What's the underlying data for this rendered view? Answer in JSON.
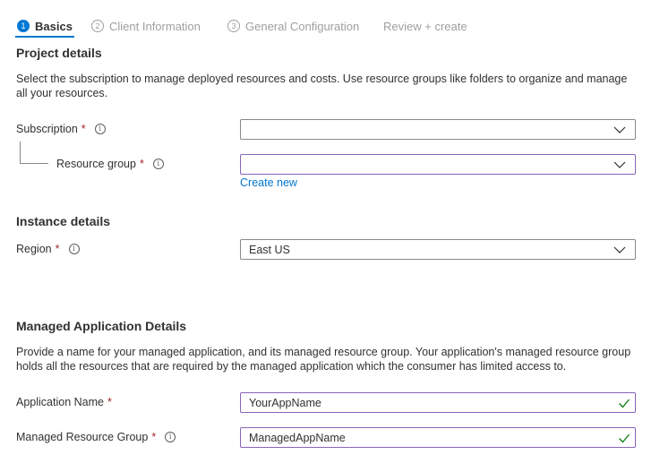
{
  "tabs": [
    {
      "number": "1",
      "label": "Basics"
    },
    {
      "number": "2",
      "label": "Client Information"
    },
    {
      "number": "3",
      "label": "General Configuration"
    },
    {
      "label": "Review + create"
    }
  ],
  "project": {
    "title": "Project details",
    "description": "Select the subscription to manage deployed resources and costs. Use resource groups like folders to organize and manage all your resources.",
    "subscription_label": "Subscription",
    "subscription_value": "",
    "resource_group_label": "Resource group",
    "resource_group_value": "",
    "create_new": "Create new"
  },
  "instance": {
    "title": "Instance details",
    "region_label": "Region",
    "region_value": "East US"
  },
  "managed": {
    "title": "Managed Application Details",
    "description": "Provide a name for your managed application, and its managed resource group. Your application's managed resource group holds all the resources that are required by the managed application which the consumer has limited access to.",
    "app_name_label": "Application Name",
    "app_name_value": "YourAppName",
    "mrg_label": "Managed Resource Group",
    "mrg_value": "ManagedAppName"
  },
  "required_marker": "*",
  "info_glyph": "i",
  "colors": {
    "accent": "#0078d4",
    "required": "#a4262c",
    "valid": "#107c10",
    "focus_border": "#8764b8"
  }
}
